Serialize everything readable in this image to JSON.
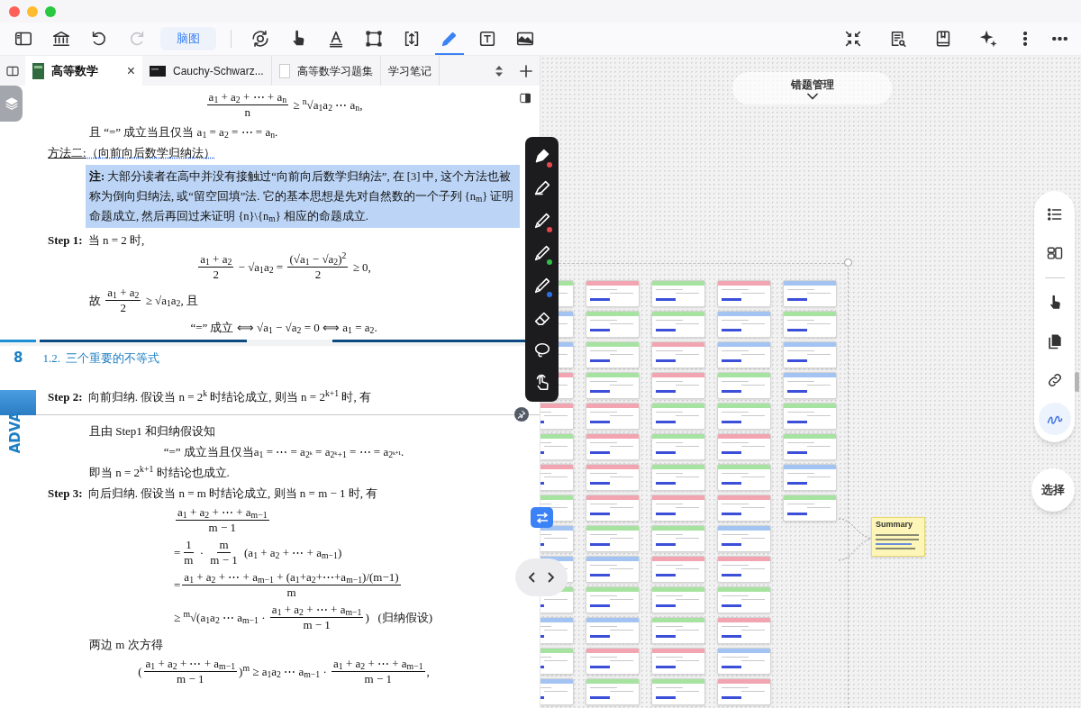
{
  "toolbar": {
    "left": [
      {
        "kind": "sidebar",
        "selected": false,
        "disabled": false
      },
      {
        "kind": "library",
        "selected": false,
        "disabled": false
      },
      {
        "kind": "undo",
        "selected": false,
        "disabled": false
      },
      {
        "kind": "redo",
        "selected": false,
        "disabled": true
      },
      {
        "kind": "label",
        "label": "脑图",
        "selected": false,
        "disabled": false
      },
      {
        "kind": "divider"
      },
      {
        "kind": "rotate",
        "selected": false,
        "disabled": false
      },
      {
        "kind": "hand",
        "selected": false,
        "disabled": false
      },
      {
        "kind": "text",
        "selected": false,
        "disabled": false
      },
      {
        "kind": "frame",
        "selected": false,
        "disabled": false
      },
      {
        "kind": "resize",
        "selected": false,
        "disabled": false
      },
      {
        "kind": "pen",
        "selected": true,
        "disabled": false
      },
      {
        "kind": "textbox",
        "selected": false,
        "disabled": false
      },
      {
        "kind": "image",
        "selected": false,
        "disabled": false
      }
    ],
    "right": [
      {
        "kind": "collapse",
        "selected": false,
        "disabled": false
      },
      {
        "kind": "docsearch",
        "selected": false,
        "disabled": false
      },
      {
        "kind": "bookmark",
        "selected": false,
        "disabled": false
      },
      {
        "kind": "sparkle",
        "selected": false,
        "disabled": false
      },
      {
        "kind": "vdots",
        "selected": false,
        "disabled": false
      },
      {
        "kind": "hdots",
        "selected": false,
        "disabled": false
      }
    ]
  },
  "tabs": [
    {
      "label": "高等数学",
      "kind": "book",
      "selected": true,
      "close": "×"
    },
    {
      "label": "Cauchy-Schwarz...",
      "kind": "dark",
      "selected": false
    },
    {
      "label": "高等数学习题集",
      "kind": "page",
      "selected": false
    },
    {
      "label": "学习笔记",
      "kind": "plain",
      "selected": false
    }
  ],
  "document": {
    "side_tab": "ADVA",
    "blocks": [
      {
        "kind": "display",
        "parts": [
          {
            "num": "a$_{1}$ + a$_{2}$ + ⋯ + a$_{n}$",
            "den": "n"
          },
          " ≥ $^{n}$√a$_{1}$a$_{2}$ ⋯ a$_{n}$,"
        ]
      },
      {
        "kind": "para",
        "parts": [
          "且 “=” 成立当且仅当 a$_{1}$ = a$_{2}$ = ⋯ = a$_{n}$."
        ]
      },
      {
        "kind": "method",
        "label": "方法二:",
        "text": "（向前向后数学归纳法）"
      },
      {
        "kind": "note",
        "text": "**注:**  大部分读者在高中并没有接触过“向前向后数学归纳法”, 在 [3] 中, 这个方法也被称为倒向归纳法, 或“留空回填”法. 它的基本思想是先对自然数的一个子列 {n$_{m}$} 证明命题成立, 然后再回过来证明 {n}\\{n$_{m}$} 相应的命题成立."
      },
      {
        "kind": "step",
        "label": "Step 1:",
        "parts": [
          "当 n = 2 时,"
        ]
      },
      {
        "kind": "display",
        "parts": [
          {
            "num": "a$_{1}$ + a$_{2}$",
            "den": "2"
          },
          " − √a$_{1}$a$_{2}$ = ",
          {
            "num": "(√a$_{1}$ − √a$_{2}$)$^{2}$",
            "den": "2"
          },
          " ≥ 0,"
        ]
      },
      {
        "kind": "para",
        "parts": [
          "故 ",
          {
            "num": "a$_{1}$ + a$_{2}$",
            "den": "2"
          },
          " ≥ √a$_{1}$a$_{2}$, 且"
        ]
      },
      {
        "kind": "display",
        "parts": [
          "“=” 成立 ⟺ √a$_{1}$ − √a$_{2}$ = 0 ⟺ a$_{1}$ = a$_{2}$."
        ]
      },
      {
        "kind": "page_break"
      },
      {
        "kind": "page_header",
        "number": "8",
        "title": "1.2.  三个重要的不等式"
      },
      {
        "kind": "step",
        "label": "Step 2:",
        "parts": [
          "向前归纳. 假设当 n = 2$^{k}$ 时结论成立, 则当 n = 2$^{k+1}$ 时, 有"
        ]
      },
      {
        "kind": "para",
        "parts": [
          "且由 Step1 和归纳假设知"
        ]
      },
      {
        "kind": "display",
        "parts": [
          "“=” 成立当且仅当a$_{1}$ = ⋯ = a$_{2ᵏ}$ = a$_{2ᵏ+1}$ = ⋯ = a$_{2ᵏ⁺¹}$."
        ]
      },
      {
        "kind": "para",
        "parts": [
          "即当 n = 2$^{k+1}$ 时结论也成立."
        ]
      },
      {
        "kind": "step",
        "label": "Step 3:",
        "parts": [
          "向后归纳. 假设当 n = m 时结论成立, 则当 n = m − 1 时, 有"
        ]
      },
      {
        "kind": "aligned",
        "parts": [
          {
            "num": "a$_{1}$ + a$_{2}$ + ⋯ + a$_{m−1}$",
            "den": "m − 1"
          }
        ]
      },
      {
        "kind": "aligned",
        "parts": [
          "=",
          {
            "num": "1",
            "den": "m"
          },
          " · ",
          {
            "num": "m",
            "den": "m − 1"
          },
          " (a$_{1}$ + a$_{2}$ + ⋯ + a$_{m−1}$)"
        ]
      },
      {
        "kind": "aligned",
        "parts": [
          "=",
          {
            "num": "a$_{1}$ + a$_{2}$ + ⋯ + a$_{m−1}$ + (a$_{1}$+a$_{2}$+⋯+a$_{m−1}$)/(m−1)",
            "den": "m"
          }
        ]
      },
      {
        "kind": "aligned",
        "parts": [
          "≥ $^{m}$√(a$_{1}$a$_{2}$ ⋯ a$_{m−1}$ · ",
          {
            "num": "a$_{1}$ + a$_{2}$ + ⋯ + a$_{m−1}$",
            "den": "m − 1"
          },
          ")   (归纳假设)"
        ]
      },
      {
        "kind": "para",
        "parts": [
          "两边 m 次方得"
        ]
      },
      {
        "kind": "display",
        "parts": [
          "(",
          {
            "num": "a$_{1}$ + a$_{2}$ + ⋯ + a$_{m−1}$",
            "den": "m − 1"
          },
          ")$^{m}$ ≥ a$_{1}$a$_{2}$ ⋯ a$_{m−1}$ · ",
          {
            "num": "a$_{1}$ + a$_{2}$ + ⋯ + a$_{m−1}$",
            "den": "m − 1"
          },
          ","
        ]
      }
    ]
  },
  "pen_tools": [
    {
      "kind": "fountain-pen",
      "color": "#e5484d"
    },
    {
      "kind": "highlighter"
    },
    {
      "kind": "pen",
      "color": "#e5484d"
    },
    {
      "kind": "pen",
      "color": "#2fbf45"
    },
    {
      "kind": "pen",
      "color": "#2f6fe5"
    },
    {
      "kind": "eraser"
    },
    {
      "kind": "lasso"
    },
    {
      "kind": "touch"
    }
  ],
  "canvas": {
    "title": "错题管理",
    "columns": [
      {
        "cards": [
          {
            "color": "#a7e3a0"
          },
          {
            "color": "#a3c4f2"
          },
          {
            "color": "#a3c4f2"
          },
          {
            "color": "#f2a5b0"
          },
          {
            "color": "#f2a5b0"
          },
          {
            "color": "#a7e3a0"
          },
          {
            "color": "#f2a5b0"
          },
          {
            "color": "#a7e3a0"
          },
          {
            "color": "#a3c4f2"
          },
          {
            "color": "#a3c4f2"
          },
          {
            "color": "#a7e3a0"
          },
          {
            "color": "#a3c4f2"
          },
          {
            "color": "#a7e3a0"
          },
          {
            "color": "#a3c4f2"
          }
        ]
      },
      {
        "cards": [
          {
            "color": "#f2a5b0"
          },
          {
            "color": "#a7e3a0"
          },
          {
            "color": "#a7e3a0"
          },
          {
            "color": "#a7e3a0"
          },
          {
            "color": "#f2a5b0"
          },
          {
            "color": "#f2a5b0"
          },
          {
            "color": "#f2a5b0"
          },
          {
            "color": "#f2a5b0"
          },
          {
            "color": "#a7e3a0"
          },
          {
            "color": "#a3c4f2"
          },
          {
            "color": "#a7e3a0"
          },
          {
            "color": "#a3c4f2"
          },
          {
            "color": "#f2a5b0"
          },
          {
            "color": "#a7e3a0"
          }
        ]
      },
      {
        "cards": [
          {
            "color": "#a7e3a0"
          },
          {
            "color": "#a7e3a0"
          },
          {
            "color": "#f2a5b0"
          },
          {
            "color": "#f2a5b0"
          },
          {
            "color": "#a7e3a0"
          },
          {
            "color": "#a7e3a0"
          },
          {
            "color": "#a7e3a0"
          },
          {
            "color": "#f2a5b0"
          },
          {
            "color": "#a7e3a0"
          },
          {
            "color": "#f2a5b0"
          },
          {
            "color": "#a7e3a0"
          },
          {
            "color": "#a7e3a0"
          },
          {
            "color": "#f2a5b0"
          },
          {
            "color": "#a7e3a0"
          }
        ]
      },
      {
        "cards": [
          {
            "color": "#f2a5b0"
          },
          {
            "color": "#a3c4f2"
          },
          {
            "color": "#a3c4f2"
          },
          {
            "color": "#a7e3a0"
          },
          {
            "color": "#a7e3a0"
          },
          {
            "color": "#f2a5b0"
          },
          {
            "color": "#a7e3a0"
          },
          {
            "color": "#f2a5b0"
          },
          {
            "color": "#a3c4f2"
          },
          {
            "color": "#f2a5b0"
          },
          {
            "color": "#a7e3a0"
          },
          {
            "color": "#f2a5b0"
          },
          {
            "color": "#a3c4f2"
          },
          {
            "color": "#f2a5b0"
          }
        ]
      },
      {
        "cards": [
          {
            "color": "#a3c4f2"
          },
          {
            "color": "#a7e3a0"
          },
          {
            "color": "#a3c4f2"
          },
          {
            "color": "#a3c4f2"
          },
          {
            "color": "#a7e3a0"
          },
          {
            "color": "#a7e3a0"
          },
          {
            "color": "#a3c4f2"
          },
          {
            "color": "#a7e3a0"
          }
        ]
      }
    ],
    "summary": {
      "title": "Summary"
    }
  },
  "right_tools": [
    {
      "kind": "outline",
      "selected": false
    },
    {
      "kind": "layout",
      "selected": false
    },
    {
      "kind": "separator"
    },
    {
      "kind": "hand",
      "selected": false
    },
    {
      "kind": "copy",
      "selected": false
    },
    {
      "kind": "link",
      "selected": false
    },
    {
      "kind": "squiggle",
      "selected": true
    }
  ],
  "select_button": "选择"
}
